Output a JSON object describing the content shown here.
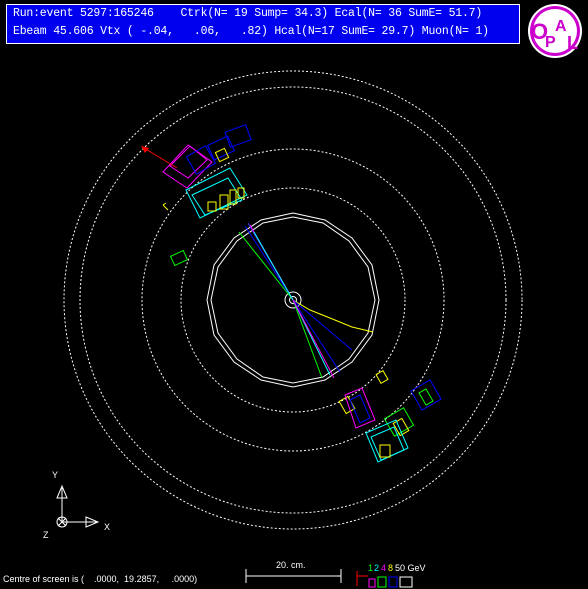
{
  "header": {
    "line1": "Run:event 5297:165246    Ctrk(N= 19 Sump= 34.3) Ecal(N= 36 SumE= 51.7)",
    "line2": "Ebeam 45.606 Vtx ( -.04,   .06,   .82) Hcal(N=17 SumE= 29.7) Muon(N= 1)"
  },
  "logo": {
    "name": "opal-logo-icon",
    "text": "OPAL",
    "bg": "#ffffff",
    "fg": "#cc00cc"
  },
  "axes": {
    "y_label": "Y",
    "x_label": "X",
    "z_label": "Z"
  },
  "footer": {
    "centre_text": "Centre of screen is (    .0000,  19.2857,     .0000)",
    "scale_label": "20. cm.",
    "energy_scale": {
      "v1": "1",
      "v2": "2",
      "v3": "4",
      "v4": "8",
      "v5": "50 GeV"
    }
  },
  "colors": {
    "header_bg": "#0000ee",
    "header_text": "#ffffff",
    "tracks": [
      "#ffff00",
      "#00ff00",
      "#0000ff",
      "#00ffff",
      "#ff00ff",
      "#ff0000"
    ]
  }
}
